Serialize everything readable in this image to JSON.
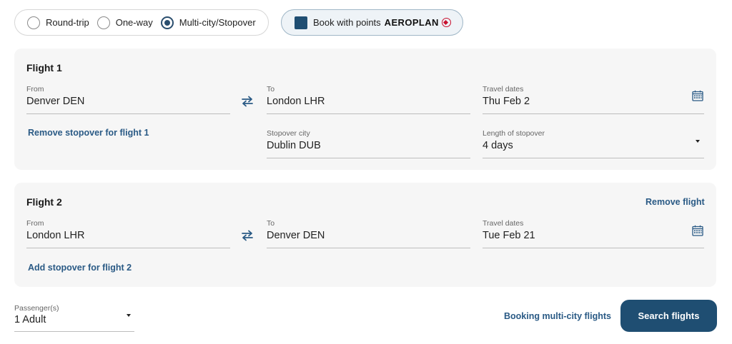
{
  "trip_type": {
    "options": [
      {
        "label": "Round-trip",
        "checked": false
      },
      {
        "label": "One-way",
        "checked": false
      },
      {
        "label": "Multi-city/Stopover",
        "checked": true
      }
    ]
  },
  "points": {
    "label": "Book with points",
    "brand": "AEROPLAN",
    "checked": true
  },
  "flight1": {
    "title": "Flight 1",
    "from": {
      "label": "From",
      "value": "Denver DEN"
    },
    "to": {
      "label": "To",
      "value": "London LHR"
    },
    "dates": {
      "label": "Travel dates",
      "value": "Thu Feb 2"
    },
    "remove_stopover": "Remove stopover for flight 1",
    "stopover_city": {
      "label": "Stopover city",
      "value": "Dublin DUB"
    },
    "stopover_length": {
      "label": "Length of stopover",
      "value": "4 days"
    }
  },
  "flight2": {
    "title": "Flight 2",
    "remove_flight": "Remove flight",
    "from": {
      "label": "From",
      "value": "London LHR"
    },
    "to": {
      "label": "To",
      "value": "Denver DEN"
    },
    "dates": {
      "label": "Travel dates",
      "value": "Tue Feb 21"
    },
    "add_stopover": "Add stopover for flight 2"
  },
  "passengers": {
    "label": "Passenger(s)",
    "value": "1 Adult"
  },
  "booking_link": "Booking multi-city flights",
  "search_button": "Search flights",
  "colors": {
    "brand": "#1f4e72",
    "link": "#2a5a85",
    "card_bg": "#f6f6f6",
    "maple_red": "#c8102e"
  },
  "icons": [
    "swap-icon",
    "calendar-icon",
    "chevron-down-icon",
    "aeroplan-maple-leaf-icon"
  ]
}
